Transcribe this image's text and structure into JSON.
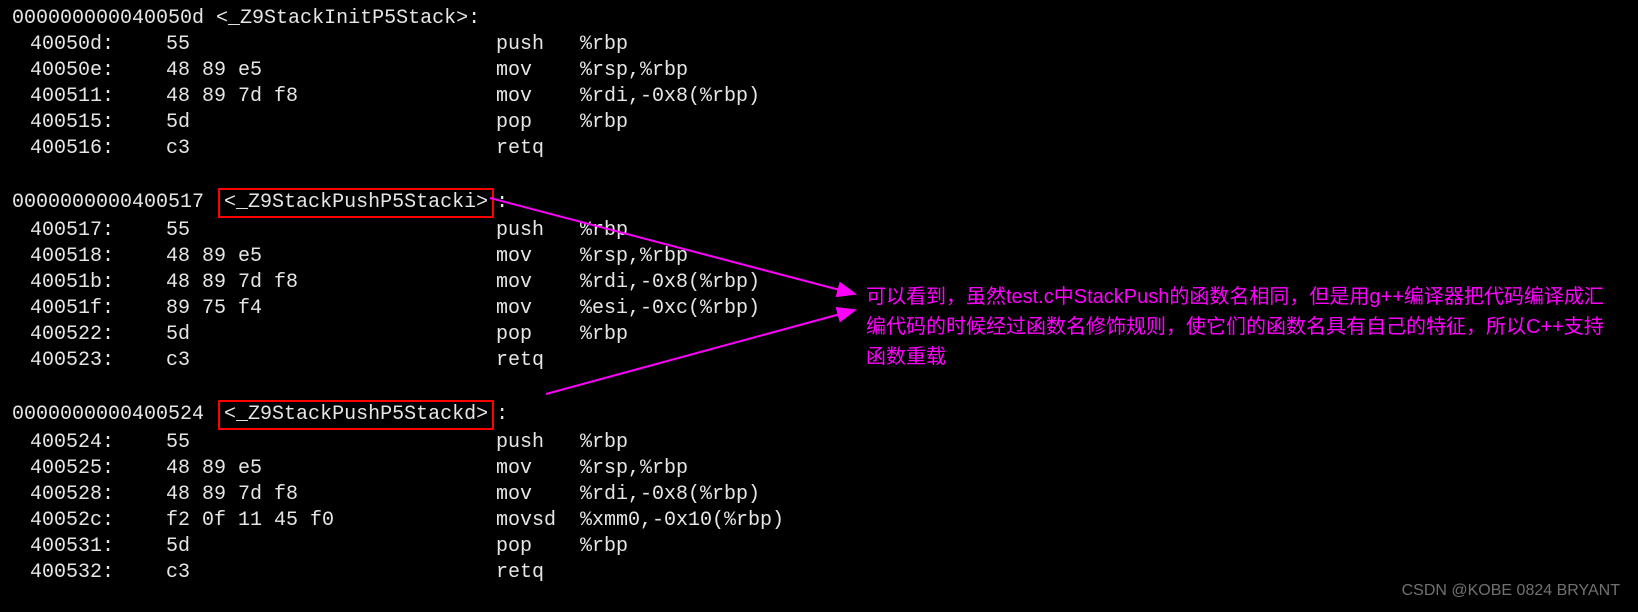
{
  "functions": [
    {
      "addr": "000000000040050d",
      "symbol": "<_Z9StackInitP5Stack>:",
      "boxed": false,
      "lines": [
        {
          "addr": "40050d:",
          "bytes": "55",
          "mnem": "push",
          "ops": "%rbp"
        },
        {
          "addr": "40050e:",
          "bytes": "48 89 e5",
          "mnem": "mov",
          "ops": "%rsp,%rbp"
        },
        {
          "addr": "400511:",
          "bytes": "48 89 7d f8",
          "mnem": "mov",
          "ops": "%rdi,-0x8(%rbp)"
        },
        {
          "addr": "400515:",
          "bytes": "5d",
          "mnem": "pop",
          "ops": "%rbp"
        },
        {
          "addr": "400516:",
          "bytes": "c3",
          "mnem": "retq",
          "ops": ""
        }
      ]
    },
    {
      "addr": "0000000000400517",
      "symbol": "<_Z9StackPushP5Stacki>",
      "suffix": ":",
      "boxed": true,
      "lines": [
        {
          "addr": "400517:",
          "bytes": "55",
          "mnem": "push",
          "ops": "%rbp"
        },
        {
          "addr": "400518:",
          "bytes": "48 89 e5",
          "mnem": "mov",
          "ops": "%rsp,%rbp"
        },
        {
          "addr": "40051b:",
          "bytes": "48 89 7d f8",
          "mnem": "mov",
          "ops": "%rdi,-0x8(%rbp)"
        },
        {
          "addr": "40051f:",
          "bytes": "89 75 f4",
          "mnem": "mov",
          "ops": "%esi,-0xc(%rbp)"
        },
        {
          "addr": "400522:",
          "bytes": "5d",
          "mnem": "pop",
          "ops": "%rbp"
        },
        {
          "addr": "400523:",
          "bytes": "c3",
          "mnem": "retq",
          "ops": ""
        }
      ]
    },
    {
      "addr": "0000000000400524",
      "symbol": "<_Z9StackPushP5Stackd>",
      "suffix": ":",
      "boxed": true,
      "lines": [
        {
          "addr": "400524:",
          "bytes": "55",
          "mnem": "push",
          "ops": "%rbp"
        },
        {
          "addr": "400525:",
          "bytes": "48 89 e5",
          "mnem": "mov",
          "ops": "%rsp,%rbp"
        },
        {
          "addr": "400528:",
          "bytes": "48 89 7d f8",
          "mnem": "mov",
          "ops": "%rdi,-0x8(%rbp)"
        },
        {
          "addr": "40052c:",
          "bytes": "f2 0f 11 45 f0",
          "mnem": "movsd",
          "ops": "%xmm0,-0x10(%rbp)"
        },
        {
          "addr": "400531:",
          "bytes": "5d",
          "mnem": "pop",
          "ops": "%rbp"
        },
        {
          "addr": "400532:",
          "bytes": "c3",
          "mnem": "retq",
          "ops": ""
        }
      ]
    }
  ],
  "comment_text": "可以看到，虽然test.c中StackPush的函数名相同，但是用g++编译器把代码编译成汇编代码的时候经过函数名修饰规则，使它们的函数名具有自己的特征，所以C++支持函数重载",
  "watermark": "CSDN @KOBE 0824 BRYANT",
  "arrow_color": "#ff00ff",
  "box_color": "#ff0000"
}
